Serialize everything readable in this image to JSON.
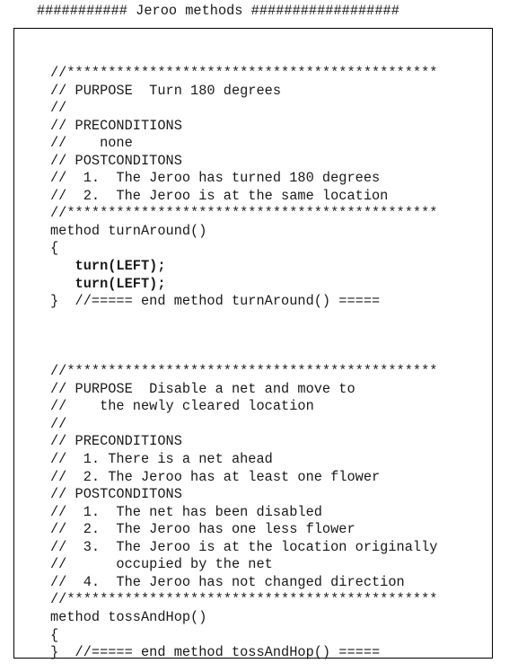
{
  "header": {
    "title": "########### Jeroo methods ##################"
  },
  "code_lines": [
    {
      "text": "//*********************************************",
      "bold": false
    },
    {
      "text": "// PURPOSE  Turn 180 degrees",
      "bold": false
    },
    {
      "text": "//",
      "bold": false
    },
    {
      "text": "// PRECONDITIONS",
      "bold": false
    },
    {
      "text": "//    none",
      "bold": false
    },
    {
      "text": "// POSTCONDITONS",
      "bold": false
    },
    {
      "text": "//  1.  The Jeroo has turned 180 degrees",
      "bold": false
    },
    {
      "text": "//  2.  The Jeroo is at the same location",
      "bold": false
    },
    {
      "text": "//*********************************************",
      "bold": false
    },
    {
      "text": "method turnAround()",
      "bold": false
    },
    {
      "text": "{",
      "bold": false
    },
    {
      "text": "   turn(LEFT);",
      "bold": true
    },
    {
      "text": "   turn(LEFT);",
      "bold": true
    },
    {
      "text": "}  //===== end method turnAround() =====",
      "bold": false
    },
    {
      "text": "",
      "bold": false
    },
    {
      "text": "",
      "bold": false
    },
    {
      "text": "",
      "bold": false
    },
    {
      "text": "//*********************************************",
      "bold": false
    },
    {
      "text": "// PURPOSE  Disable a net and move to",
      "bold": false
    },
    {
      "text": "//    the newly cleared location",
      "bold": false
    },
    {
      "text": "//",
      "bold": false
    },
    {
      "text": "// PRECONDITIONS",
      "bold": false
    },
    {
      "text": "//  1. There is a net ahead",
      "bold": false
    },
    {
      "text": "//  2. The Jeroo has at least one flower",
      "bold": false
    },
    {
      "text": "// POSTCONDITONS",
      "bold": false
    },
    {
      "text": "//  1.  The net has been disabled",
      "bold": false
    },
    {
      "text": "//  2.  The Jeroo has one less flower",
      "bold": false
    },
    {
      "text": "//  3.  The Jeroo is at the location originally",
      "bold": false
    },
    {
      "text": "//      occupied by the net",
      "bold": false
    },
    {
      "text": "//  4.  The Jeroo has not changed direction",
      "bold": false
    },
    {
      "text": "//*********************************************",
      "bold": false
    },
    {
      "text": "method tossAndHop()",
      "bold": false
    },
    {
      "text": "{",
      "bold": false
    },
    {
      "text": "}  //===== end method tossAndHop() =====",
      "bold": false
    }
  ]
}
